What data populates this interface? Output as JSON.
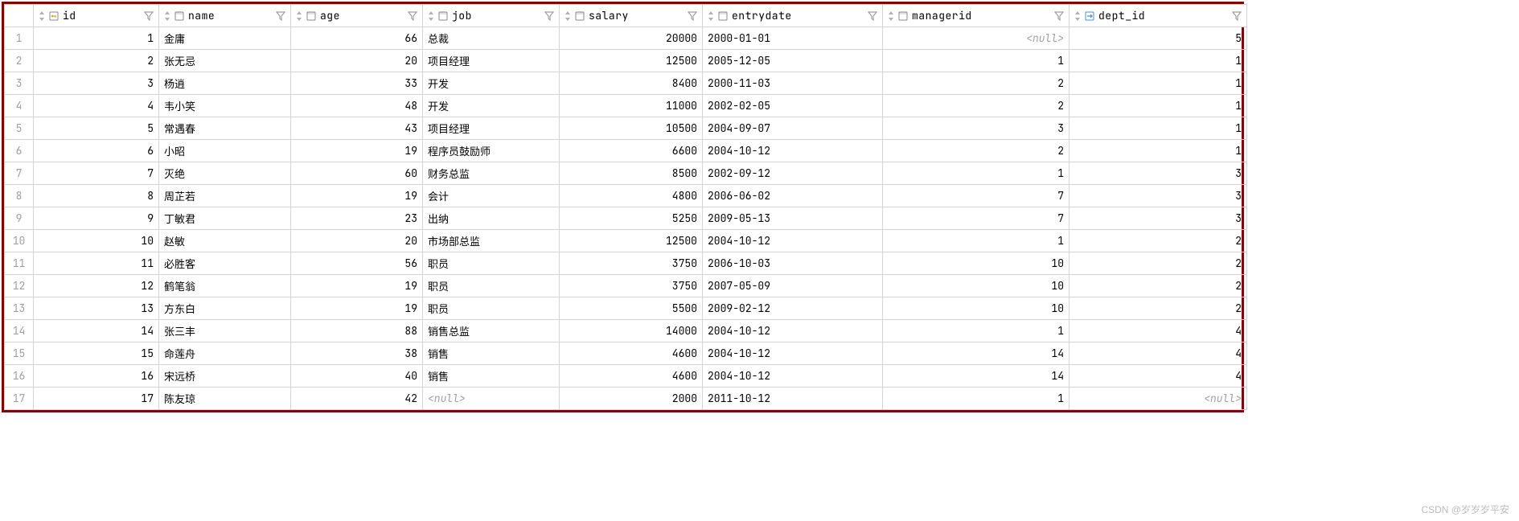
{
  "columns": [
    {
      "key": "id",
      "label": "id",
      "align": "num",
      "icon": "key"
    },
    {
      "key": "name",
      "label": "name",
      "align": "txt",
      "icon": "col"
    },
    {
      "key": "age",
      "label": "age",
      "align": "num",
      "icon": "col"
    },
    {
      "key": "job",
      "label": "job",
      "align": "txt",
      "icon": "col"
    },
    {
      "key": "salary",
      "label": "salary",
      "align": "num",
      "icon": "col"
    },
    {
      "key": "entrydate",
      "label": "entrydate",
      "align": "txt",
      "icon": "col"
    },
    {
      "key": "managerid",
      "label": "managerid",
      "align": "num",
      "icon": "col"
    },
    {
      "key": "dept_id",
      "label": "dept_id",
      "align": "num",
      "icon": "fk"
    }
  ],
  "null_label": "<null>",
  "rows": [
    {
      "n": "1",
      "id": "1",
      "name": "金庸",
      "age": "66",
      "job": "总裁",
      "salary": "20000",
      "entrydate": "2000-01-01",
      "managerid": null,
      "dept_id": "5"
    },
    {
      "n": "2",
      "id": "2",
      "name": "张无忌",
      "age": "20",
      "job": "项目经理",
      "salary": "12500",
      "entrydate": "2005-12-05",
      "managerid": "1",
      "dept_id": "1"
    },
    {
      "n": "3",
      "id": "3",
      "name": "杨逍",
      "age": "33",
      "job": "开发",
      "salary": "8400",
      "entrydate": "2000-11-03",
      "managerid": "2",
      "dept_id": "1"
    },
    {
      "n": "4",
      "id": "4",
      "name": "韦小笑",
      "age": "48",
      "job": "开发",
      "salary": "11000",
      "entrydate": "2002-02-05",
      "managerid": "2",
      "dept_id": "1"
    },
    {
      "n": "5",
      "id": "5",
      "name": "常遇春",
      "age": "43",
      "job": "项目经理",
      "salary": "10500",
      "entrydate": "2004-09-07",
      "managerid": "3",
      "dept_id": "1"
    },
    {
      "n": "6",
      "id": "6",
      "name": "小昭",
      "age": "19",
      "job": "程序员鼓励师",
      "salary": "6600",
      "entrydate": "2004-10-12",
      "managerid": "2",
      "dept_id": "1"
    },
    {
      "n": "7",
      "id": "7",
      "name": "灭绝",
      "age": "60",
      "job": "财务总监",
      "salary": "8500",
      "entrydate": "2002-09-12",
      "managerid": "1",
      "dept_id": "3"
    },
    {
      "n": "8",
      "id": "8",
      "name": "周芷若",
      "age": "19",
      "job": "会计",
      "salary": "4800",
      "entrydate": "2006-06-02",
      "managerid": "7",
      "dept_id": "3"
    },
    {
      "n": "9",
      "id": "9",
      "name": "丁敏君",
      "age": "23",
      "job": "出纳",
      "salary": "5250",
      "entrydate": "2009-05-13",
      "managerid": "7",
      "dept_id": "3"
    },
    {
      "n": "10",
      "id": "10",
      "name": "赵敏",
      "age": "20",
      "job": "市场部总监",
      "salary": "12500",
      "entrydate": "2004-10-12",
      "managerid": "1",
      "dept_id": "2"
    },
    {
      "n": "11",
      "id": "11",
      "name": "必胜客",
      "age": "56",
      "job": "职员",
      "salary": "3750",
      "entrydate": "2006-10-03",
      "managerid": "10",
      "dept_id": "2"
    },
    {
      "n": "12",
      "id": "12",
      "name": "鹤笔翁",
      "age": "19",
      "job": "职员",
      "salary": "3750",
      "entrydate": "2007-05-09",
      "managerid": "10",
      "dept_id": "2"
    },
    {
      "n": "13",
      "id": "13",
      "name": "方东白",
      "age": "19",
      "job": "职员",
      "salary": "5500",
      "entrydate": "2009-02-12",
      "managerid": "10",
      "dept_id": "2"
    },
    {
      "n": "14",
      "id": "14",
      "name": "张三丰",
      "age": "88",
      "job": "销售总监",
      "salary": "14000",
      "entrydate": "2004-10-12",
      "managerid": "1",
      "dept_id": "4"
    },
    {
      "n": "15",
      "id": "15",
      "name": "命莲舟",
      "age": "38",
      "job": "销售",
      "salary": "4600",
      "entrydate": "2004-10-12",
      "managerid": "14",
      "dept_id": "4"
    },
    {
      "n": "16",
      "id": "16",
      "name": "宋远桥",
      "age": "40",
      "job": "销售",
      "salary": "4600",
      "entrydate": "2004-10-12",
      "managerid": "14",
      "dept_id": "4"
    },
    {
      "n": "17",
      "id": "17",
      "name": "陈友琼",
      "age": "42",
      "job": null,
      "salary": "2000",
      "entrydate": "2011-10-12",
      "managerid": "1",
      "dept_id": null
    }
  ],
  "watermark": "CSDN @岁岁岁平安"
}
